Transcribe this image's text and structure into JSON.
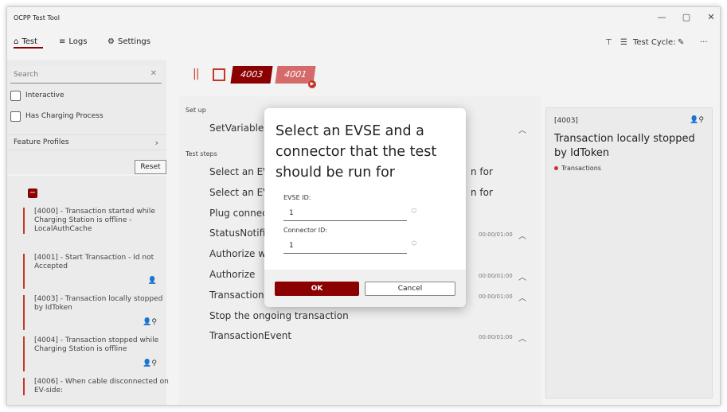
{
  "window": {
    "title": "OCPP Test Tool",
    "controls": {
      "minimize": "—",
      "maximize": "▢",
      "close": "✕"
    }
  },
  "nav": {
    "tabs": [
      {
        "label": "Test",
        "icon": "home-icon"
      },
      {
        "label": "Logs",
        "icon": "list-icon"
      },
      {
        "label": "Settings",
        "icon": "gear-icon"
      }
    ],
    "test_cycle_label": "Test Cycle:",
    "more": "···"
  },
  "sidebar": {
    "search_placeholder": "Search",
    "filters": [
      {
        "label": "Interactive"
      },
      {
        "label": "Has Charging Process"
      }
    ],
    "feature_profiles": "Feature Profiles",
    "reset": "Reset",
    "collapse_symbol": "−",
    "tests": [
      {
        "text": "[4000] - Transaction started while Charging Station is offline - LocalAuthCache"
      },
      {
        "text": "[4001] - Start Transaction - Id not Accepted"
      },
      {
        "text": "[4003] - Transaction locally stopped by IdToken"
      },
      {
        "text": "[4004] - Transaction stopped while Charging Station is offline"
      },
      {
        "text": "[4006] - When cable disconnected on EV-side:"
      }
    ]
  },
  "toolbar": {
    "tags": [
      {
        "label": "4003"
      },
      {
        "label": "4001"
      }
    ]
  },
  "center": {
    "setup_label": "Set up",
    "setup_step": "SetVariables",
    "steps_label": "Test steps",
    "steps": [
      {
        "label": "Select an EV",
        "suffix": "n for",
        "time": ""
      },
      {
        "label": "Select an EV",
        "suffix": "n for",
        "time": ""
      },
      {
        "label": "Plug connec",
        "time": ""
      },
      {
        "label": "StatusNotifi",
        "time": "00:00/01:00"
      },
      {
        "label": "Authorize w",
        "time": ""
      },
      {
        "label": "Authorize",
        "time": "00:00/01:00"
      },
      {
        "label": "TransactionE",
        "time": "00:00/01:00"
      },
      {
        "label": "Stop the ongoing transaction",
        "time": ""
      },
      {
        "label": "TransactionEvent",
        "time": "00:00/01:00"
      }
    ]
  },
  "info": {
    "id": "[4003]",
    "title": "Transaction locally stopped by IdToken",
    "tag": "Transactions"
  },
  "dialog": {
    "title": "Select an EVSE and a connector that the test should be run for",
    "evse_label": "EVSE ID:",
    "evse_value": "1",
    "connector_label": "Connector ID:",
    "connector_value": "1",
    "ok": "OK",
    "cancel": "Cancel"
  },
  "colors": {
    "accent": "#8b0000",
    "accent_light": "#d46a6a",
    "status_red": "#c0392b"
  }
}
